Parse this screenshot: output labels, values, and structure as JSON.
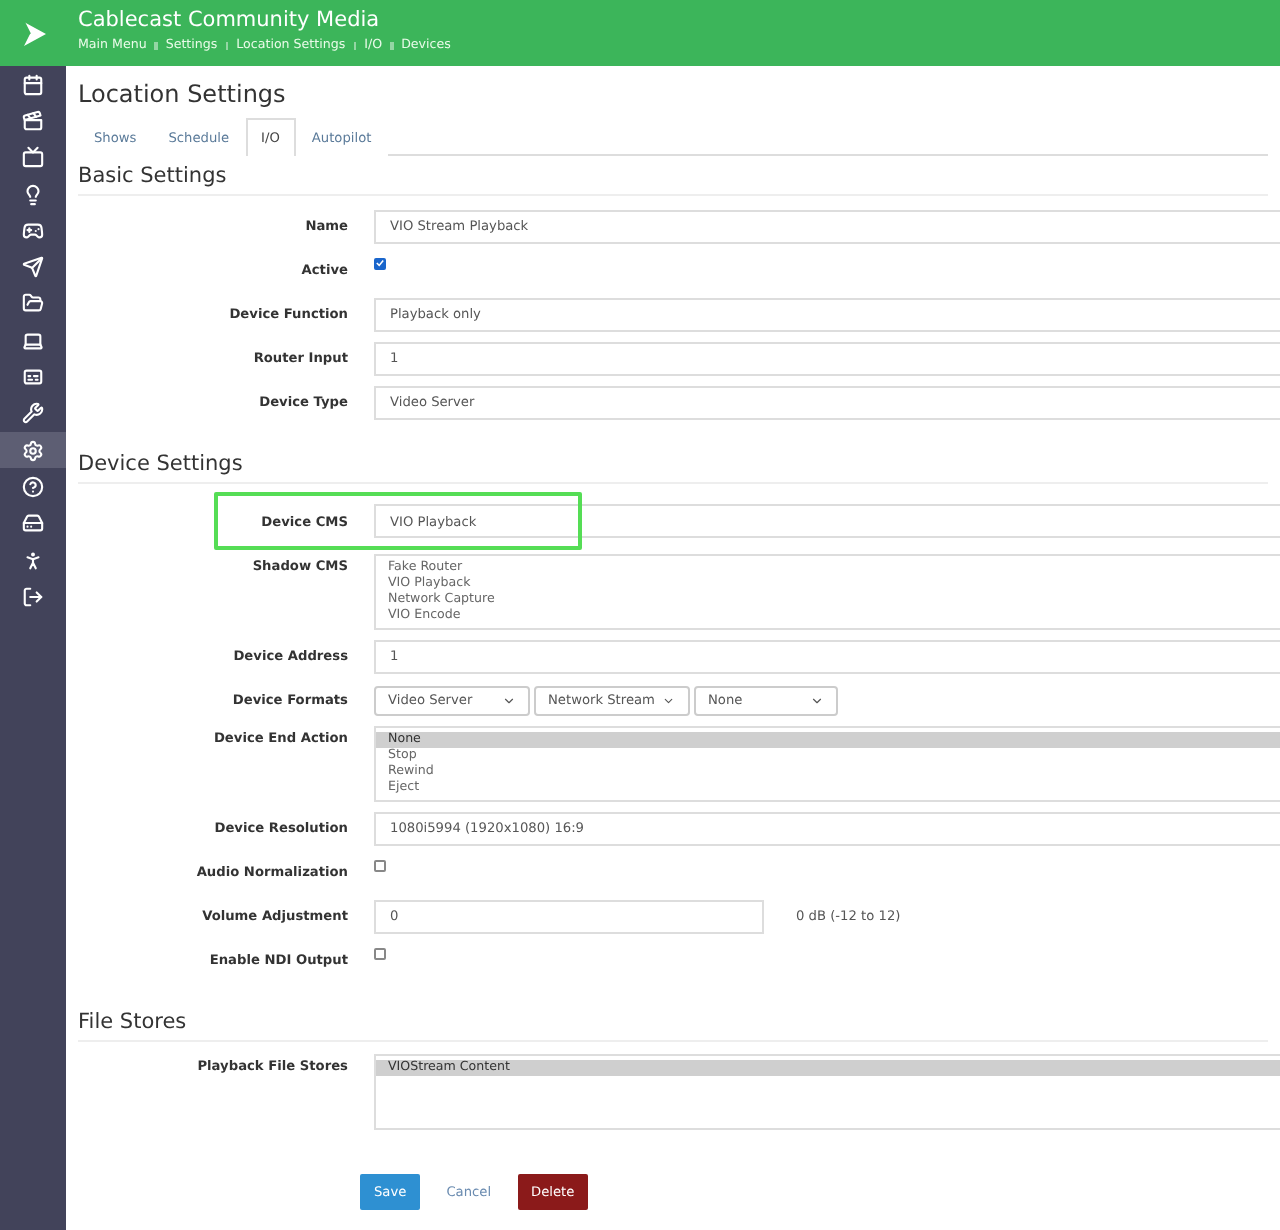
{
  "header": {
    "title": "Cablecast Community Media",
    "breadcrumbs": [
      "Main Menu",
      "Settings",
      "Location Settings",
      "I/O",
      "Devices"
    ]
  },
  "sidebar": {
    "items": [
      {
        "selected": false
      },
      {
        "selected": false
      },
      {
        "selected": false
      },
      {
        "selected": false
      },
      {
        "selected": false
      },
      {
        "selected": false
      },
      {
        "selected": false
      },
      {
        "selected": false
      },
      {
        "selected": false
      },
      {
        "selected": false
      },
      {
        "selected": true
      },
      {
        "selected": false
      },
      {
        "selected": false
      },
      {
        "selected": false
      },
      {
        "selected": false
      }
    ]
  },
  "page_title": "Location Settings",
  "tabs": [
    {
      "label": "Shows",
      "selected": false
    },
    {
      "label": "Schedule",
      "selected": false
    },
    {
      "label": "I/O",
      "selected": true
    },
    {
      "label": "Autopilot",
      "selected": false
    }
  ],
  "sections": [
    {
      "title": "Basic Settings",
      "fields": [
        {
          "kind": "text",
          "label": "Name",
          "value": "VIO Stream Playback"
        },
        {
          "kind": "checkbox",
          "label": "Active",
          "checked": true
        },
        {
          "kind": "text",
          "label": "Device Function",
          "value": "Playback only"
        },
        {
          "kind": "text",
          "label": "Router Input",
          "value": "1"
        },
        {
          "kind": "text",
          "label": "Device Type",
          "value": "Video Server"
        }
      ]
    },
    {
      "title": "Device Settings",
      "fields": [
        {
          "kind": "text",
          "label": "Device CMS",
          "value": "VIO Playback",
          "highlighted": true
        },
        {
          "kind": "listbox",
          "label": "Shadow CMS",
          "options": [
            {
              "label": "Fake Router",
              "selected": false
            },
            {
              "label": "VIO Playback",
              "selected": false
            },
            {
              "label": "Network Capture",
              "selected": false
            },
            {
              "label": "VIO Encode",
              "selected": false
            }
          ]
        },
        {
          "kind": "text",
          "label": "Device Address",
          "value": "1"
        },
        {
          "kind": "selects",
          "label": "Device Formats",
          "values": [
            "Video Server",
            "Network Stream",
            "None"
          ]
        },
        {
          "kind": "listbox",
          "label": "Device End Action",
          "options": [
            {
              "label": "None",
              "selected": true
            },
            {
              "label": "Stop",
              "selected": false
            },
            {
              "label": "Rewind",
              "selected": false
            },
            {
              "label": "Eject",
              "selected": false
            }
          ]
        },
        {
          "kind": "text",
          "label": "Device Resolution",
          "value": "1080i5994 (1920x1080) 16:9"
        },
        {
          "kind": "checkbox",
          "label": "Audio Normalization",
          "checked": false
        },
        {
          "kind": "short_text",
          "label": "Volume Adjustment",
          "value": "0",
          "hint": "0 dB (-12 to 12)"
        },
        {
          "kind": "checkbox",
          "label": "Enable NDI Output",
          "checked": false
        }
      ]
    },
    {
      "title": "File Stores",
      "fields": [
        {
          "kind": "tallbox",
          "label": "Playback File Stores",
          "options": [
            {
              "label": "VIOStream Content",
              "selected": true
            }
          ]
        }
      ]
    }
  ],
  "buttons": [
    {
      "kind": "primary",
      "label": "Save"
    },
    {
      "kind": "link",
      "label": "Cancel"
    },
    {
      "kind": "danger",
      "label": "Delete"
    }
  ]
}
